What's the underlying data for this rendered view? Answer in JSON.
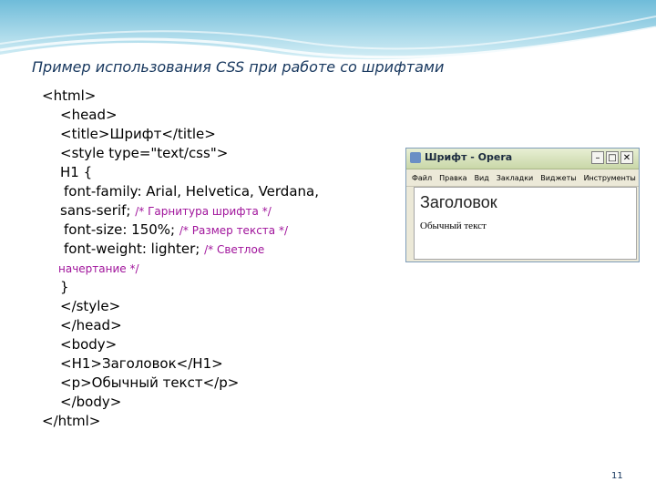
{
  "slide": {
    "title": "Пример использования CSS  при работе со шрифтами",
    "page_number": "11"
  },
  "code": {
    "l1": "<html>",
    "l2": "<head>",
    "l3": "<title>Шрифт</title>",
    "l4": "<style type=\"text/css\">",
    "l5": "H1 {",
    "l6": "font-family: Arial, Helvetica, Verdana,",
    "l7_text": "sans-serif; ",
    "l7_comment": "/* Гарнитура шрифта */",
    "l8_text": "font-size: 150%; ",
    "l8_comment": "/* Размер текста */",
    "l9_text": "font-weight: lighter; ",
    "l9_comment": "/* Светлое",
    "l10_comment": "начертание */",
    "l11": "}",
    "l12": "</style>",
    "l13": "</head>",
    "l14": "<body>",
    "l15": "<H1>Заголовок</H1>",
    "l16": "<p>Обычный текст</p>",
    "l17": "</body>",
    "l18": "</html>"
  },
  "browser": {
    "window_title": "Шрифт - Opera",
    "menu": [
      "Файл",
      "Правка",
      "Вид",
      "Закладки",
      "Виджеты",
      "Инструменты"
    ],
    "heading": "Заголовок",
    "paragraph": "Обычный текст"
  },
  "colors": {
    "comment": "#a0139b",
    "title": "#17375e",
    "wave": "#9fd3e6"
  }
}
